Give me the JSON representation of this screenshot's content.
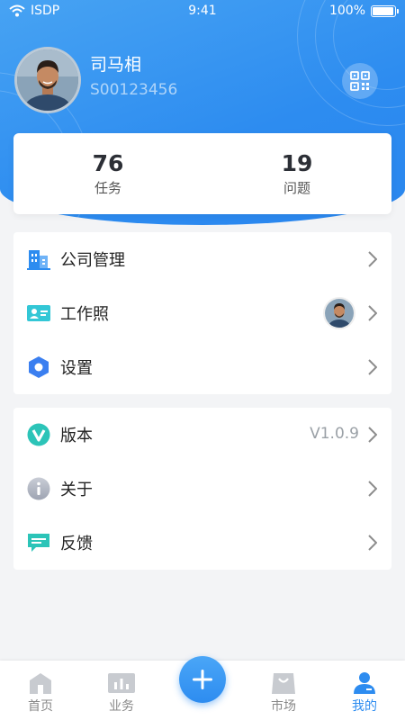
{
  "status_bar": {
    "carrier": "ISDP",
    "time": "9:41",
    "battery": "100%"
  },
  "profile": {
    "name": "司马相",
    "user_id": "S00123456"
  },
  "stats": [
    {
      "value": "76",
      "label": "任务"
    },
    {
      "value": "19",
      "label": "问题"
    }
  ],
  "menu_group_1": [
    {
      "label": "公司管理",
      "icon": "building-icon"
    },
    {
      "label": "工作照",
      "icon": "id-card-icon"
    },
    {
      "label": "设置",
      "icon": "settings-hexagon-icon"
    }
  ],
  "menu_group_2": [
    {
      "label": "版本",
      "icon": "version-v-icon",
      "value": "V1.0.9"
    },
    {
      "label": "关于",
      "icon": "info-icon"
    },
    {
      "label": "反馈",
      "icon": "feedback-icon"
    }
  ],
  "tabbar": [
    {
      "label": "首页",
      "icon": "home-icon"
    },
    {
      "label": "业务",
      "icon": "business-chart-icon"
    },
    {
      "label": "",
      "icon": "plus-icon"
    },
    {
      "label": "市场",
      "icon": "market-bag-icon"
    },
    {
      "label": "我的",
      "icon": "profile-icon",
      "active": true
    }
  ],
  "colors": {
    "primary": "#2D8CF0",
    "background": "#F3F4F6",
    "text": "#222222",
    "muted": "#9AA0A6"
  }
}
